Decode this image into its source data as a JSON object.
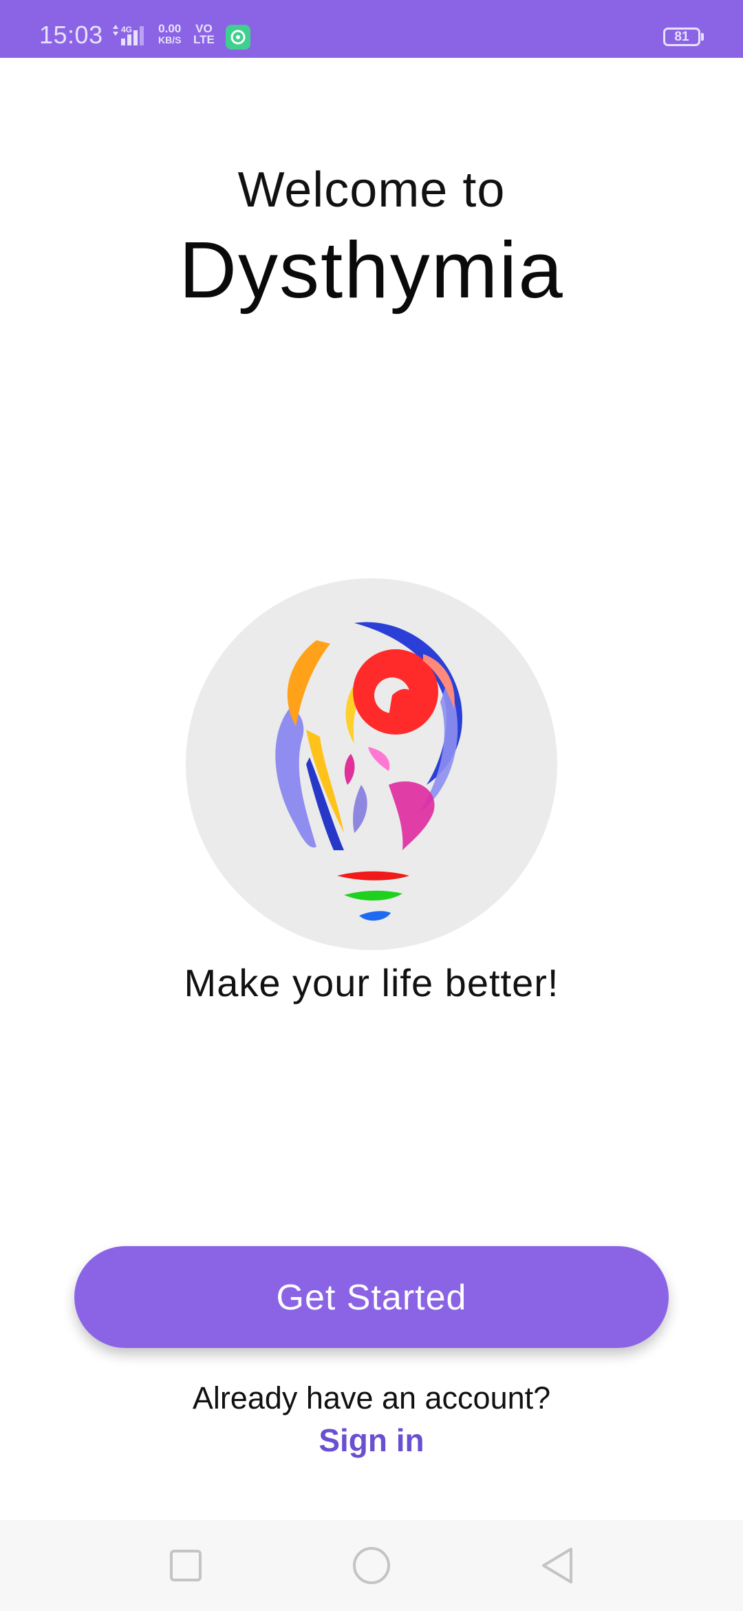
{
  "status_bar": {
    "time": "15:03",
    "network_type": "4G",
    "speed_value": "0.00",
    "speed_unit": "KB/S",
    "volte_top": "VO",
    "volte_bottom": "LTE",
    "battery_level": "81",
    "background_color": "#8b64e6"
  },
  "header": {
    "welcome": "Welcome to",
    "app_name": "Dysthymia"
  },
  "logo": {
    "icon": "colorful-lightbulb-icon",
    "circle_color": "#ebebeb"
  },
  "tagline": "Make your life better!",
  "cta": {
    "label": "Get Started",
    "color": "#8b64e6"
  },
  "account": {
    "prompt": "Already have an account?",
    "sign_in_label": "Sign in",
    "link_color": "#6a4fd1"
  },
  "nav_bar": {
    "items": [
      {
        "icon": "recents-square-icon"
      },
      {
        "icon": "home-circle-icon"
      },
      {
        "icon": "back-triangle-icon"
      }
    ]
  }
}
